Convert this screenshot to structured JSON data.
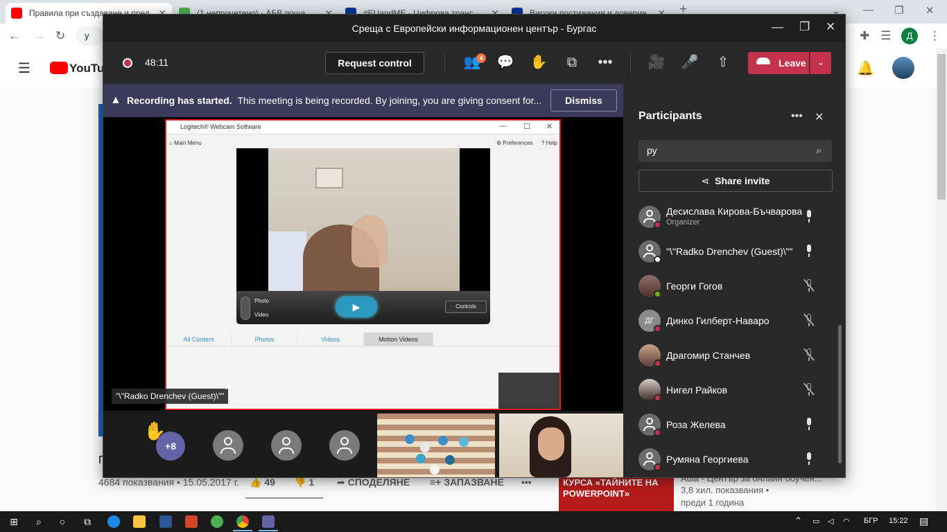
{
  "browser": {
    "tabs": [
      {
        "title": "Правила при създаване и пред",
        "favicon_color": "#ff0000",
        "active": true
      },
      {
        "title": "(1 непрочетено) - АБВ поща",
        "favicon_color": "#4caf50",
        "active": false
      },
      {
        "title": "#EUandME - Цифрова трансфор",
        "favicon_color": "#003399",
        "active": false
      },
      {
        "title": "Високи постижения и доверие",
        "favicon_color": "#003399",
        "active": false
      }
    ],
    "new_tab": "+",
    "omnibox_text": "y",
    "profile_initial": "Д"
  },
  "youtube": {
    "logo_text": "YouTube",
    "title_fragment": "П",
    "views_date": "4684 показвания • 15.05.2017 г.",
    "likes": "49",
    "dislikes": "1",
    "share_label": "СПОДЕЛЯНЕ",
    "save_label": "ЗАПАЗВАНЕ",
    "thumb_text": "КУРСА «ТАЙНИТЕ НА POWERPOINT»",
    "rec_channel": "Aula - Център за онлайн обучен...",
    "rec_views": "3,8 хил. показвания •",
    "rec_age": "преди 1 година"
  },
  "teams": {
    "window_title": "Среща с Европейски информационен център - Бургас",
    "timer": "48:11",
    "request_control": "Request control",
    "participants_count": "4",
    "leave_label": "Leave",
    "banner": {
      "bold": "Recording has started.",
      "text": "This meeting is being recorded. By joining, you are giving consent for...",
      "dismiss": "Dismiss"
    },
    "shared_window": {
      "title": "Logitech® Webcam Software",
      "main_menu": "Main Menu",
      "preferences": "Preferences",
      "help": "Help",
      "photo": "Photo",
      "video": "Video",
      "controls": "Controls",
      "tabs": [
        "All Content",
        "Photos",
        "Videos",
        "Motion Videos"
      ]
    },
    "presenter_name": "\"\\\"Radko Drenchev (Guest)\\\"\"",
    "gallery_more": "+8",
    "panel": {
      "title": "Participants",
      "search_value": "ру",
      "share_invite": "Share invite",
      "participants": [
        {
          "name": "Десислава Кирова-Бъчварова",
          "role": "Organizer",
          "muted": false,
          "avatar": "generic",
          "status": "busy"
        },
        {
          "name": "\"\\\"Radko Drenchev (Guest)\\\"\"",
          "role": "",
          "muted": false,
          "avatar": "generic",
          "status": "away"
        },
        {
          "name": "Георги Гогов",
          "role": "",
          "muted": true,
          "avatar": "photo",
          "status": "ok"
        },
        {
          "name": "Динко Гилберт-Наваро",
          "role": "",
          "muted": true,
          "avatar": "initials",
          "initials": "ДГ",
          "status": "busy"
        },
        {
          "name": "Драгомир Станчев",
          "role": "",
          "muted": true,
          "avatar": "photo2",
          "status": "busy"
        },
        {
          "name": "Нигел Райков",
          "role": "",
          "muted": true,
          "avatar": "photo3",
          "status": "busy"
        },
        {
          "name": "Роза Желева",
          "role": "",
          "muted": false,
          "avatar": "generic",
          "status": "busy"
        },
        {
          "name": "Румяна Георгиева",
          "role": "",
          "muted": false,
          "avatar": "generic",
          "status": "busy"
        }
      ]
    },
    "colors": {
      "leave": "#c4314b",
      "accent": "#6264a7",
      "badge": "#e97548"
    }
  },
  "taskbar": {
    "language": "БГР",
    "time": "15:22"
  }
}
